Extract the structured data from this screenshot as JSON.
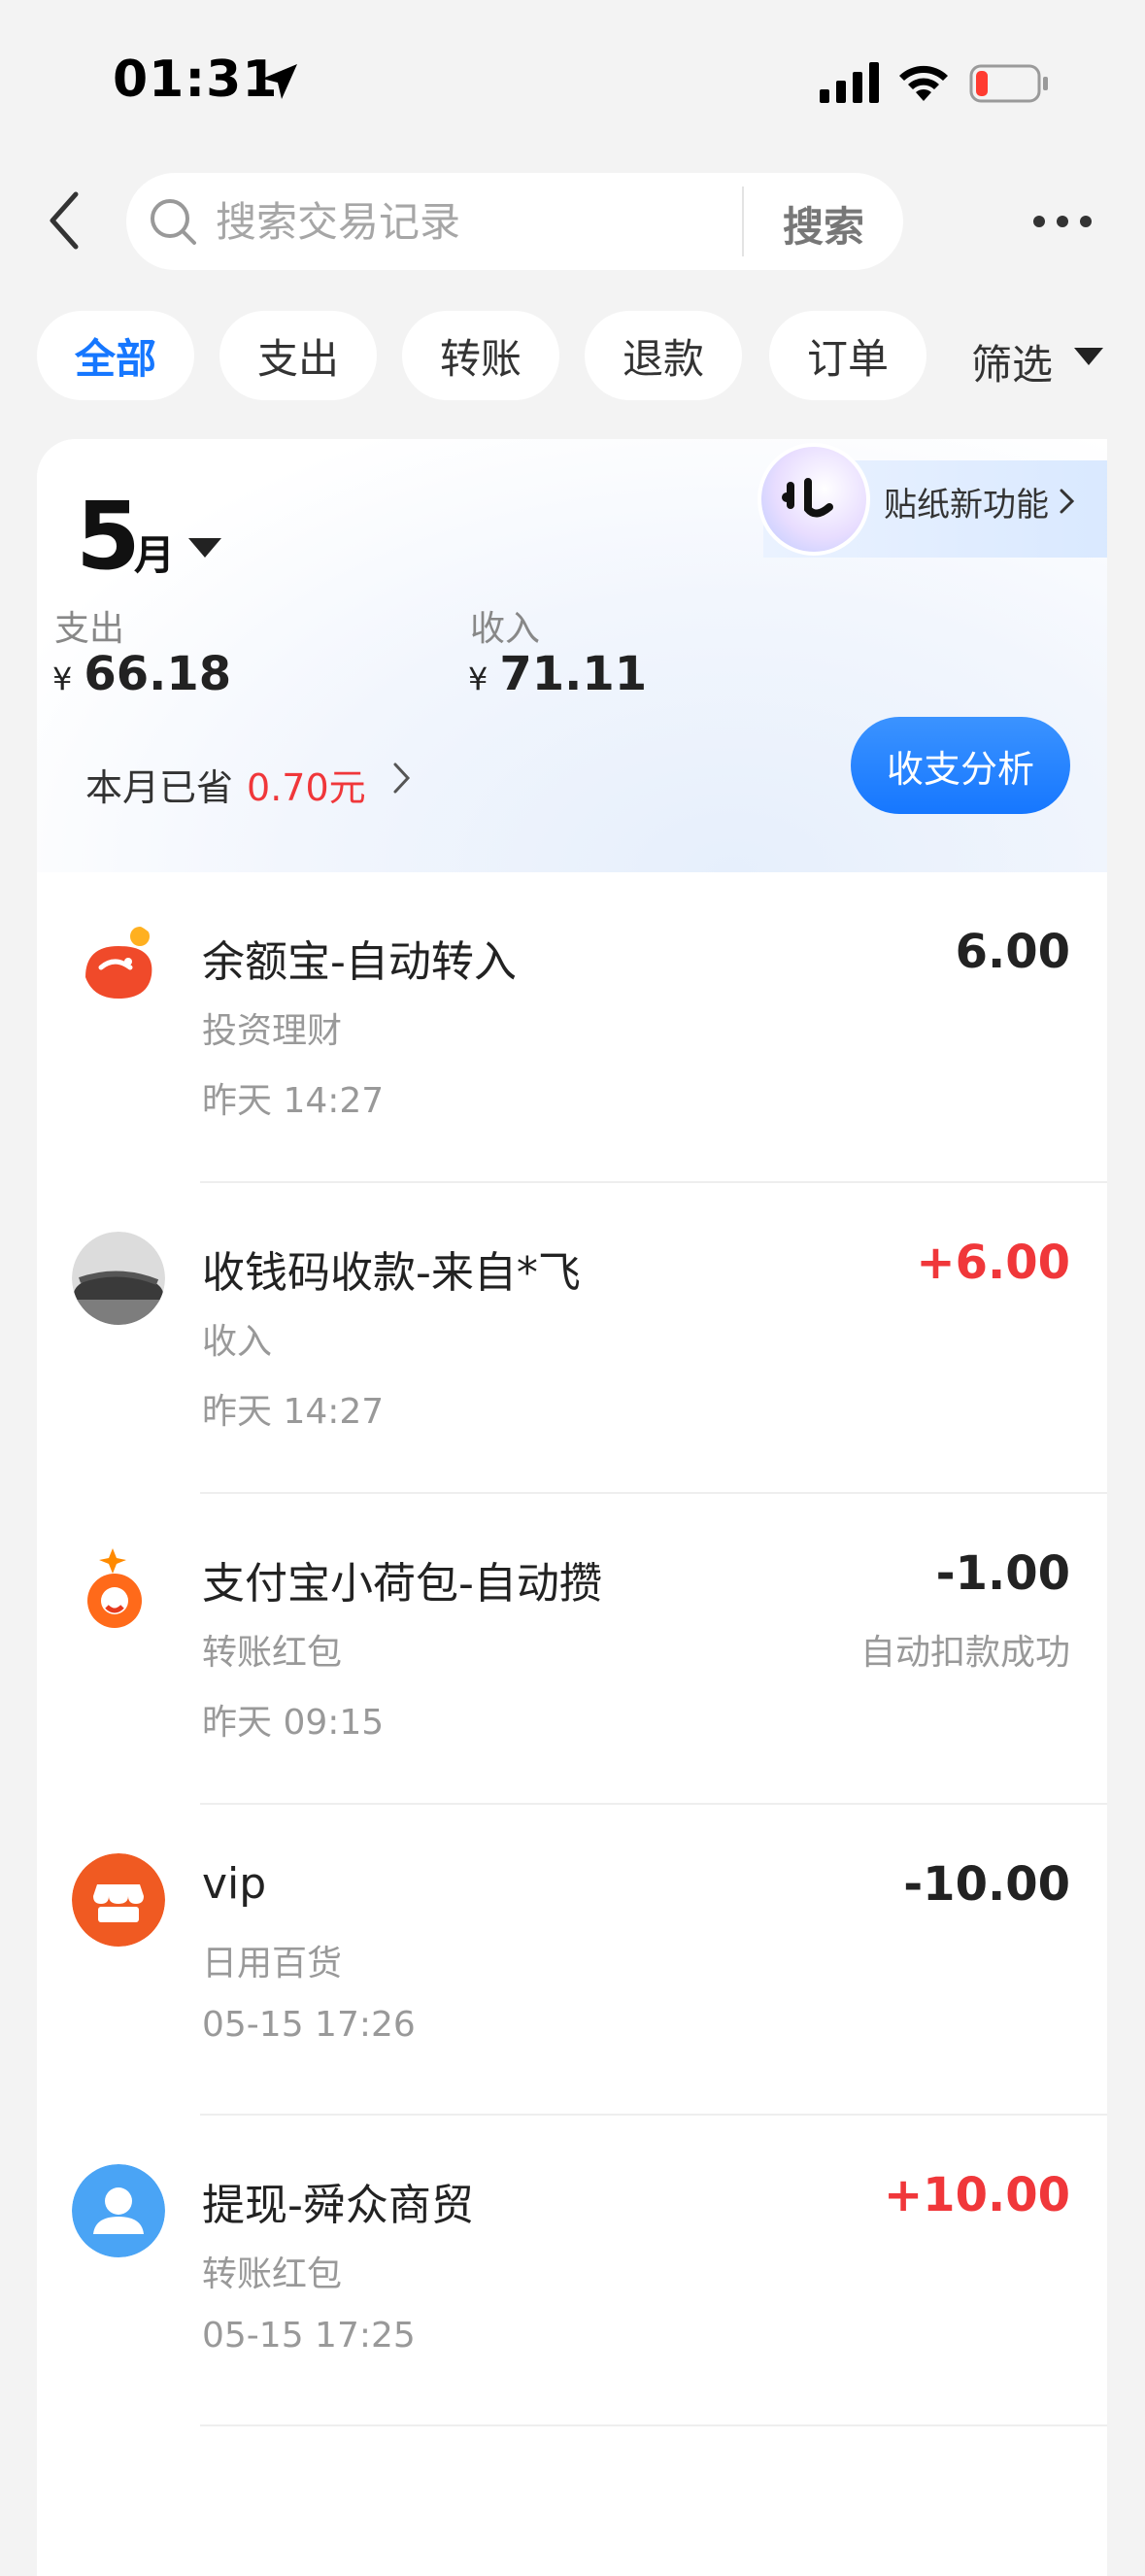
{
  "status_bar": {
    "time": "01:31"
  },
  "header": {
    "search_placeholder": "搜索交易记录",
    "search_button": "搜索"
  },
  "tabs": [
    {
      "label": "全部",
      "active": true
    },
    {
      "label": "支出",
      "active": false
    },
    {
      "label": "转账",
      "active": false
    },
    {
      "label": "退款",
      "active": false
    },
    {
      "label": "订单",
      "active": false
    }
  ],
  "filter_label": "筛选",
  "summary": {
    "month": "5",
    "month_unit": "月",
    "sticker_label": "贴纸新功能",
    "expense_label": "支出",
    "expense_value": "66.18",
    "income_label": "收入",
    "income_value": "71.11",
    "currency": "¥",
    "saved_label": "本月已省",
    "saved_amount": "0.70元",
    "analysis_button": "收支分析"
  },
  "transactions": [
    {
      "title": "余额宝-自动转入",
      "category": "投资理财",
      "time": "昨天 14:27",
      "amount": "6.00",
      "status": "",
      "icon": "yuebao-icon"
    },
    {
      "title": "收钱码收款-来自*飞",
      "category": "收入",
      "time": "昨天 14:27",
      "amount": "+6.00",
      "status": "",
      "icon": "avatar-photo-icon"
    },
    {
      "title": "支付宝小荷包-自动攒",
      "category": "转账红包",
      "time": "昨天 09:15",
      "amount": "-1.00",
      "status": "自动扣款成功",
      "icon": "xiaohebao-icon"
    },
    {
      "title": "vip",
      "category": "日用百货",
      "time": "05-15 17:26",
      "amount": "-10.00",
      "status": "",
      "icon": "shop-icon"
    },
    {
      "title": "提现-舜众商贸",
      "category": "转账红包",
      "time": "05-15 17:25",
      "amount": "+10.00",
      "status": "",
      "icon": "user-icon"
    }
  ],
  "colors": {
    "accent": "#1677ff",
    "positive_amount": "#f0373a",
    "background": "#f3f3f3"
  }
}
